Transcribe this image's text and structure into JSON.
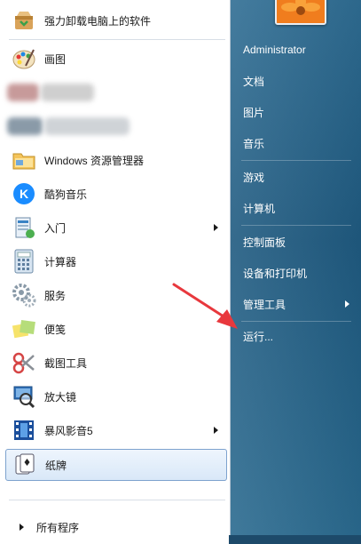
{
  "left_items": [
    {
      "label": "强力卸载电脑上的软件",
      "icon": "uninstall-box-icon",
      "has_arrow": false
    },
    {
      "label": "画图",
      "icon": "paint-palette-icon",
      "has_arrow": false
    },
    {
      "label": "Windows 资源管理器",
      "icon": "folder-explorer-icon",
      "has_arrow": false
    },
    {
      "label": "酷狗音乐",
      "icon": "kugou-k-icon",
      "has_arrow": false
    },
    {
      "label": "入门",
      "icon": "getting-started-icon",
      "has_arrow": true
    },
    {
      "label": "计算器",
      "icon": "calculator-icon",
      "has_arrow": false
    },
    {
      "label": "服务",
      "icon": "services-gear-icon",
      "has_arrow": false
    },
    {
      "label": "便笺",
      "icon": "sticky-notes-icon",
      "has_arrow": false
    },
    {
      "label": "截图工具",
      "icon": "snipping-scissors-icon",
      "has_arrow": false
    },
    {
      "label": "放大镜",
      "icon": "magnifier-icon",
      "has_arrow": false
    },
    {
      "label": "暴风影音5",
      "icon": "baofeng-film-icon",
      "has_arrow": true
    },
    {
      "label": "纸牌",
      "icon": "solitaire-cards-icon",
      "has_arrow": false
    }
  ],
  "all_programs": "所有程序",
  "right_items": [
    {
      "label": "Administrator",
      "has_arrow": false
    },
    {
      "label": "文档",
      "has_arrow": false
    },
    {
      "label": "图片",
      "has_arrow": false
    },
    {
      "label": "音乐",
      "has_arrow": false
    },
    {
      "label": "游戏",
      "has_arrow": false
    },
    {
      "label": "计算机",
      "has_arrow": false
    },
    {
      "label": "控制面板",
      "has_arrow": false
    },
    {
      "label": "设备和打印机",
      "has_arrow": false
    },
    {
      "label": "管理工具",
      "has_arrow": true
    },
    {
      "label": "运行...",
      "has_arrow": false
    }
  ],
  "colors": {
    "right_pane": "#2a6a8f",
    "highlight_border": "#7da2ce",
    "annotation_arrow": "#e8383d"
  }
}
